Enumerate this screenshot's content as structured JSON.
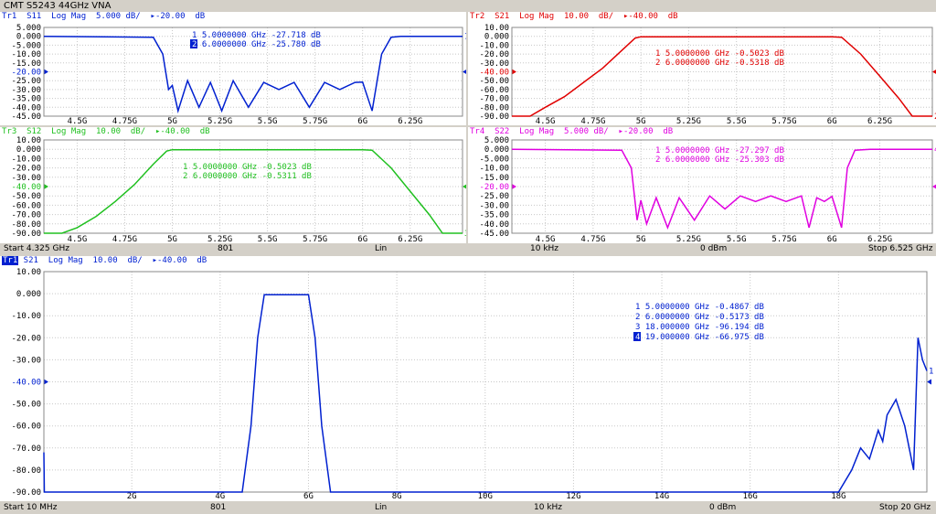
{
  "app_title": "CMT S5243 44GHz VNA",
  "colors": {
    "blue": "#0020d0",
    "red": "#e00000",
    "green": "#20c020",
    "magenta": "#e000e0"
  },
  "status_top": {
    "start": "Start 4.325 GHz",
    "points": "801",
    "sweep": "Lin",
    "ifbw": "10 kHz",
    "power": "0 dBm",
    "stop": "Stop 6.525 GHz"
  },
  "status_bottom": {
    "start": "Start 10 MHz",
    "points": "801",
    "sweep": "Lin",
    "ifbw": "10 kHz",
    "power": "0 dBm",
    "stop": "Stop 20 GHz"
  },
  "traces": [
    {
      "id": "tr1",
      "header": "Tr1  S11  Log Mag  5.000 dB/  ▸-20.00  dB",
      "color": "blue",
      "y_ticks": [
        "5.000",
        "0.000",
        "-5.000",
        "-10.00",
        "-15.00",
        "-20.00",
        "-25.00",
        "-30.00",
        "-35.00",
        "-40.00",
        "-45.00"
      ],
      "ref_label": "-20.00",
      "x_ticks": [
        "4.5G",
        "4.75G",
        "5G",
        "5.25G",
        "5.5G",
        "5.75G",
        "6G",
        "6.25G"
      ],
      "markers": [
        "1  5.0000000  GHz  -27.718  dB",
        "2  6.0000000  GHz  -25.780  dB"
      ],
      "chart_data": {
        "type": "line",
        "xlim": [
          4.325,
          6.525
        ],
        "ylim": [
          -45,
          5
        ],
        "unit_x": "GHz",
        "unit_y": "dB",
        "x": [
          4.325,
          4.9,
          4.95,
          4.98,
          5.0,
          5.03,
          5.08,
          5.14,
          5.2,
          5.26,
          5.32,
          5.4,
          5.48,
          5.56,
          5.64,
          5.72,
          5.8,
          5.88,
          5.96,
          6.0,
          6.05,
          6.1,
          6.15,
          6.2,
          6.525
        ],
        "y": [
          0,
          -0.5,
          -10,
          -30,
          -27.7,
          -42,
          -25,
          -40,
          -26,
          -42,
          -25,
          -40,
          -26,
          -30,
          -26,
          -40,
          -26,
          -30,
          -26,
          -25.8,
          -42,
          -10,
          -0.5,
          0,
          0
        ]
      }
    },
    {
      "id": "tr2",
      "header": "Tr2  S21  Log Mag  10.00  dB/  ▸-40.00  dB",
      "color": "red",
      "y_ticks": [
        "10.00",
        "0.000",
        "-10.00",
        "-20.00",
        "-30.00",
        "-40.00",
        "-50.00",
        "-60.00",
        "-70.00",
        "-80.00",
        "-90.00"
      ],
      "ref_label": "-40.00",
      "x_ticks": [
        "4.5G",
        "4.75G",
        "5G",
        "5.25G",
        "5.5G",
        "5.75G",
        "6G",
        "6.25G"
      ],
      "markers": [
        "1  5.0000000  GHz  -0.5023  dB",
        "2  6.0000000  GHz  -0.5318  dB"
      ],
      "chart_data": {
        "type": "line",
        "xlim": [
          4.325,
          6.525
        ],
        "ylim": [
          -90,
          10
        ],
        "unit_x": "GHz",
        "unit_y": "dB",
        "x": [
          4.325,
          4.42,
          4.5,
          4.6,
          4.7,
          4.8,
          4.9,
          4.97,
          5.0,
          5.5,
          6.0,
          6.05,
          6.15,
          6.25,
          6.35,
          6.42,
          6.525
        ],
        "y": [
          -90,
          -90,
          -80,
          -68,
          -52,
          -36,
          -16,
          -2,
          -0.5,
          -0.5,
          -0.53,
          -1,
          -20,
          -45,
          -70,
          -90,
          -90
        ]
      }
    },
    {
      "id": "tr3",
      "header": "Tr3  S12  Log Mag  10.00  dB/  ▸-40.00  dB",
      "color": "green",
      "y_ticks": [
        "10.00",
        "0.000",
        "-10.00",
        "-20.00",
        "-30.00",
        "-40.00",
        "-50.00",
        "-60.00",
        "-70.00",
        "-80.00",
        "-90.00"
      ],
      "ref_label": "-40.00",
      "x_ticks": [
        "4.5G",
        "4.75G",
        "5G",
        "5.25G",
        "5.5G",
        "5.75G",
        "6G",
        "6.25G"
      ],
      "markers": [
        "1  5.0000000  GHz  -0.5023  dB",
        "2  6.0000000  GHz  -0.5311  dB"
      ],
      "chart_data": {
        "type": "line",
        "xlim": [
          4.325,
          6.525
        ],
        "ylim": [
          -90,
          10
        ],
        "unit_x": "GHz",
        "unit_y": "dB",
        "x": [
          4.325,
          4.42,
          4.5,
          4.6,
          4.7,
          4.8,
          4.9,
          4.97,
          5.0,
          5.5,
          6.0,
          6.05,
          6.15,
          6.25,
          6.35,
          6.42,
          6.525
        ],
        "y": [
          -90,
          -90,
          -84,
          -72,
          -56,
          -38,
          -16,
          -2,
          -0.5,
          -0.5,
          -0.53,
          -1,
          -20,
          -45,
          -70,
          -90,
          -90
        ]
      }
    },
    {
      "id": "tr4",
      "header": "Tr4  S22  Log Mag  5.000 dB/  ▸-20.00  dB",
      "color": "magenta",
      "y_ticks": [
        "5.000",
        "0.000",
        "-5.000",
        "-10.00",
        "-15.00",
        "-20.00",
        "-25.00",
        "-30.00",
        "-35.00",
        "-40.00",
        "-45.00"
      ],
      "ref_label": "-20.00",
      "x_ticks": [
        "4.5G",
        "4.75G",
        "5G",
        "5.25G",
        "5.5G",
        "5.75G",
        "6G",
        "6.25G"
      ],
      "markers": [
        "1  5.0000000  GHz  -27.297  dB",
        "2  6.0000000  GHz  -25.303  dB"
      ],
      "chart_data": {
        "type": "line",
        "xlim": [
          4.325,
          6.525
        ],
        "ylim": [
          -45,
          5
        ],
        "unit_x": "GHz",
        "unit_y": "dB",
        "x": [
          4.325,
          4.9,
          4.95,
          4.98,
          5.0,
          5.03,
          5.08,
          5.14,
          5.2,
          5.28,
          5.36,
          5.44,
          5.52,
          5.6,
          5.68,
          5.76,
          5.84,
          5.88,
          5.92,
          5.96,
          6.0,
          6.05,
          6.08,
          6.12,
          6.2,
          6.525
        ],
        "y": [
          0,
          -0.5,
          -10,
          -38,
          -27.3,
          -40,
          -26,
          -42,
          -26,
          -38,
          -25,
          -32,
          -25,
          -28,
          -25,
          -28,
          -25,
          -42,
          -26,
          -28,
          -25.3,
          -42,
          -10,
          -0.5,
          0,
          0
        ]
      }
    },
    {
      "id": "trb",
      "header": " S21  Log Mag  10.00  dB/  ▸-40.00  dB",
      "tag": "Tr1",
      "color": "blue",
      "y_ticks": [
        "10.00",
        "0.000",
        "-10.00",
        "-20.00",
        "-30.00",
        "-40.00",
        "-50.00",
        "-60.00",
        "-70.00",
        "-80.00",
        "-90.00"
      ],
      "ref_label": "-40.00",
      "x_ticks": [
        "2G",
        "4G",
        "6G",
        "8G",
        "10G",
        "12G",
        "14G",
        "16G",
        "18G"
      ],
      "markers": [
        "1  5.0000000  GHz  -0.4867  dB",
        "2  6.0000000  GHz  -0.5173  dB",
        "3  18.000000  GHz  -96.194  dB",
        "4  19.000000  GHz  -66.975  dB"
      ],
      "chart_data": {
        "type": "line",
        "xlim": [
          0.01,
          20
        ],
        "ylim": [
          -90,
          10
        ],
        "unit_x": "GHz",
        "unit_y": "dB",
        "x": [
          0.01,
          0.02,
          0.05,
          4.5,
          4.7,
          4.85,
          5.0,
          6.0,
          6.15,
          6.3,
          6.5,
          18.0,
          18.3,
          18.5,
          18.7,
          18.9,
          19.0,
          19.1,
          19.3,
          19.5,
          19.7,
          19.8,
          19.9,
          20.0
        ],
        "y": [
          -72,
          -90,
          -90,
          -90,
          -60,
          -20,
          -0.5,
          -0.5,
          -20,
          -60,
          -90,
          -90,
          -80,
          -70,
          -75,
          -62,
          -67,
          -55,
          -48,
          -60,
          -80,
          -20,
          -30,
          -35
        ]
      }
    }
  ]
}
